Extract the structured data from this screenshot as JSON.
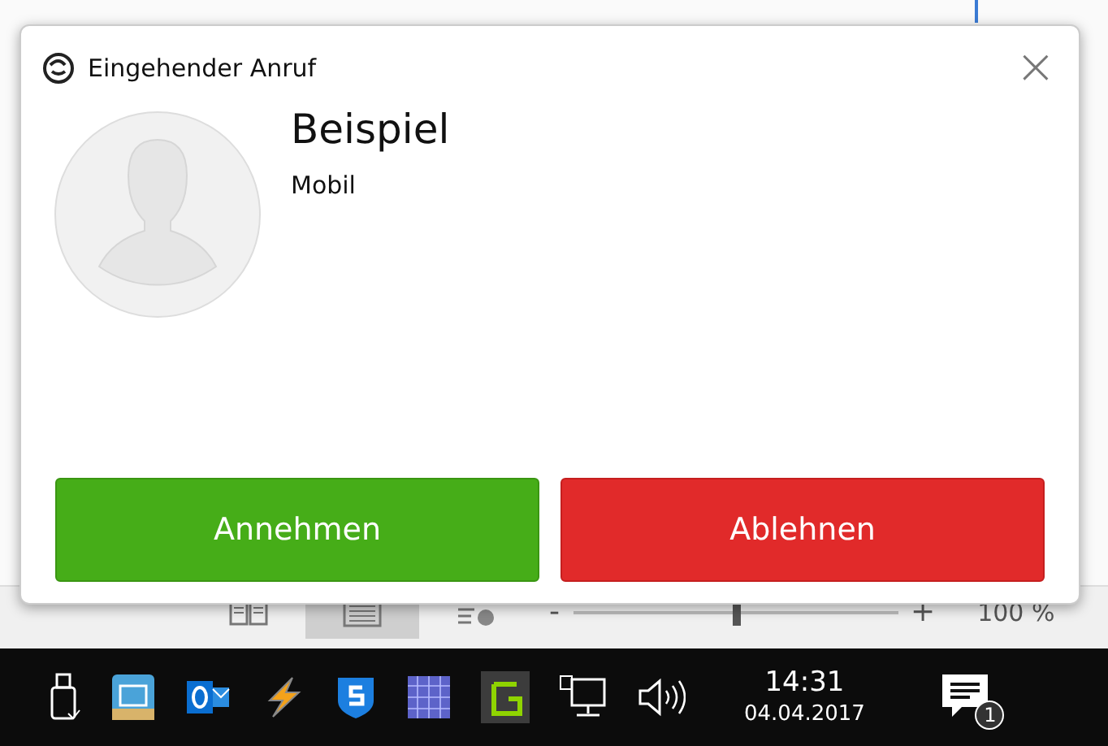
{
  "popup": {
    "title": "Eingehender Anruf",
    "close": "×",
    "caller_name": "Beispiel",
    "caller_type": "Mobil",
    "buttons": [
      {
        "label": "Annehmen",
        "kind": "accept"
      },
      {
        "label": "Ablehnen",
        "kind": "decline"
      }
    ]
  },
  "status_bar": {
    "views": [
      {
        "selected": false
      },
      {
        "selected": true
      },
      {
        "selected": false
      }
    ],
    "zoom_minus": "-",
    "zoom_plus": "+",
    "zoom": {
      "level": 0.5
    },
    "zoom_reading": "100 %"
  },
  "taskbar": {
    "time": "14:31",
    "date": "04.04.2017",
    "notification_count": "1"
  }
}
